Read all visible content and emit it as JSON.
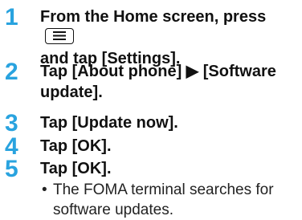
{
  "steps": [
    {
      "number": "1",
      "line1": "From the Home screen, press",
      "line2": "and tap [Settings].",
      "key_icon": "menu-key-icon"
    },
    {
      "number": "2",
      "line1": "Tap [About phone] ▶ [Software",
      "line2": "update]."
    },
    {
      "number": "3",
      "text": "Tap [Update now]."
    },
    {
      "number": "4",
      "text": "Tap [OK]."
    },
    {
      "number": "5",
      "text": "Tap [OK].",
      "note": {
        "bullet": "•",
        "text": "The FOMA terminal searches for software updates."
      }
    }
  ],
  "colors": {
    "step_number": "#29a3df",
    "text": "#111111"
  }
}
